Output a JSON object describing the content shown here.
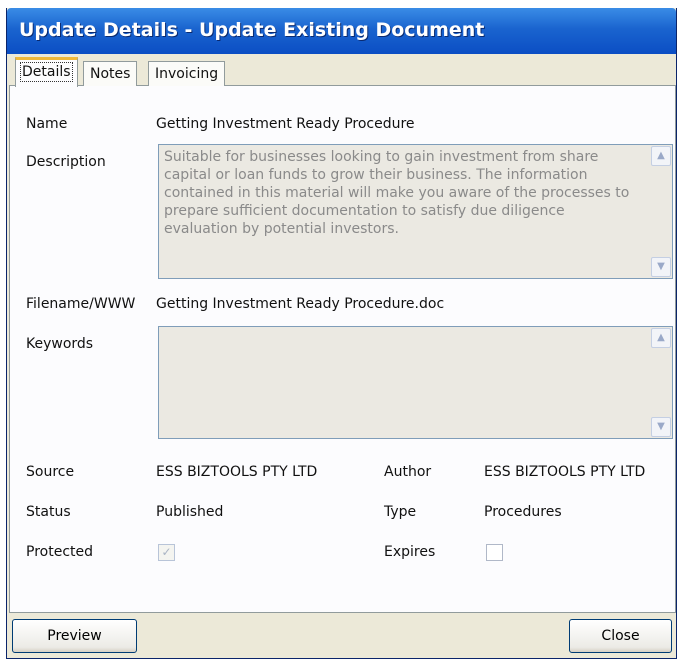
{
  "window": {
    "title": "Update Details - Update Existing Document"
  },
  "tabs": [
    {
      "label": "Details",
      "active": true
    },
    {
      "label": "Notes",
      "active": false
    },
    {
      "label": "Invoicing",
      "active": false
    }
  ],
  "fields": {
    "name": {
      "label": "Name",
      "value": "Getting Investment Ready Procedure"
    },
    "description": {
      "label": "Description",
      "value": "Suitable for businesses looking to gain investment from share capital or loan funds to grow their business.  The information contained in this material will make you aware of the processes to prepare sufficient documentation to satisfy due diligence evaluation by potential investors."
    },
    "filename": {
      "label": "Filename/WWW",
      "value": "Getting Investment Ready Procedure.doc"
    },
    "keywords": {
      "label": "Keywords",
      "value": ""
    },
    "source": {
      "label": "Source",
      "value": "ESS BIZTOOLS PTY LTD"
    },
    "author": {
      "label": "Author",
      "value": "ESS BIZTOOLS PTY LTD"
    },
    "status": {
      "label": "Status",
      "value": "Published"
    },
    "type": {
      "label": "Type",
      "value": "Procedures"
    },
    "protected": {
      "label": "Protected",
      "checked": true
    },
    "expires": {
      "label": "Expires",
      "checked": false
    }
  },
  "buttons": {
    "preview": "Preview",
    "close": "Close"
  },
  "colors": {
    "titlebar": "#0b4ec4",
    "window_bg": "#ece9d8",
    "active_tab_accent": "#f0b93a"
  }
}
